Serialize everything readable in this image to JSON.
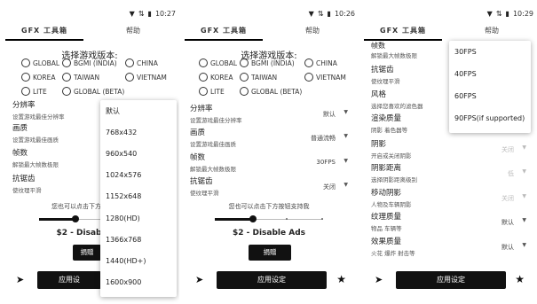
{
  "status_bar": {
    "icons": [
      "wifi-icon",
      "data-icon",
      "battery-icon"
    ],
    "times": [
      "10:27",
      "10:26",
      "10:29"
    ]
  },
  "tabs": {
    "tool": "GFX 工具箱",
    "help": "帮助"
  },
  "version_title": "选择游戏版本:",
  "versions": [
    "GLOBAL",
    "BGMI (INDIA)",
    "CHINA",
    "KOREA",
    "TAIWAN",
    "VIETNAM",
    "LITE",
    "GLOBAL (BETA)"
  ],
  "panel1": {
    "settings": [
      {
        "label": "分辨率",
        "desc": "设置游戏最佳分辨率"
      },
      {
        "label": "画质",
        "desc": "设置游戏最佳画质"
      },
      {
        "label": "帧数",
        "desc": "解锁最大帧数极限"
      },
      {
        "label": "抗锯齿",
        "desc": "使纹理平滑"
      }
    ],
    "support_text": "您也可以点击下方",
    "price": "$2 - Disab",
    "donate": "捐赠",
    "apply": "应用设",
    "resolution_options": [
      "默认",
      "768x432",
      "960x540",
      "1024x576",
      "1152x648",
      "1280(HD)",
      "1366x768",
      "1440(HD+)",
      "1600x900"
    ]
  },
  "panel2": {
    "settings": [
      {
        "label": "分辨率",
        "desc": "设置游戏最佳分辨率",
        "value": "默认"
      },
      {
        "label": "画质",
        "desc": "设置游戏最佳画质",
        "value": "普通流畅"
      },
      {
        "label": "帧数",
        "desc": "解锁最大帧数极限",
        "value": "30FPS"
      },
      {
        "label": "抗锯齿",
        "desc": "使纹理平滑",
        "value": "关闭"
      }
    ],
    "support_text": "您也可以点击下方按钮支持我",
    "price": "$2 - Disable Ads",
    "donate": "捐赠",
    "apply": "应用设定"
  },
  "panel3": {
    "peek_label": "帧数",
    "settings": [
      {
        "label": "抗锯齿",
        "desc": "使纹理平滑",
        "value": ""
      },
      {
        "label": "风格",
        "desc": "选择您喜欢的滤色器",
        "value": ""
      },
      {
        "label": "渲染质量",
        "desc": "阴影 着色器等",
        "value": ""
      },
      {
        "label": "阴影",
        "desc": "开启或关闭阴影",
        "value": "关闭"
      },
      {
        "label": "阴影距离",
        "desc": "选择阴影距离级别",
        "value": "低"
      },
      {
        "label": "移动阴影",
        "desc": "人物及车辆阴影",
        "value": "关闭"
      },
      {
        "label": "纹理质量",
        "desc": "物品 车辆等",
        "value": "默认"
      },
      {
        "label": "效果质量",
        "desc": "火花 爆炸 射击等",
        "value": "默认"
      }
    ],
    "fps_options": [
      "30FPS",
      "40FPS",
      "60FPS",
      "90FPS(if supported)"
    ],
    "apply": "应用设定"
  }
}
